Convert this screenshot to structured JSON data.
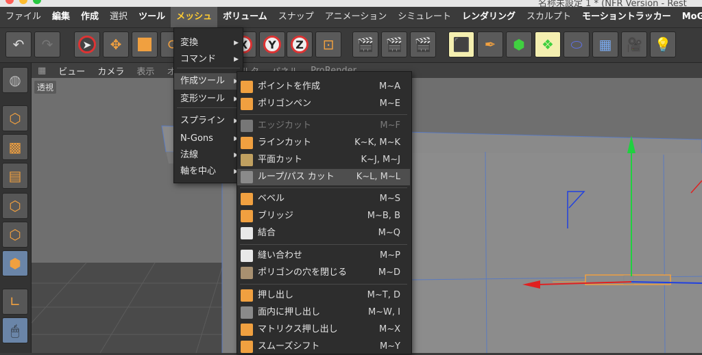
{
  "window": {
    "title": "名称未設定 1 * (NFR Version - Rest"
  },
  "menubar": {
    "items": [
      {
        "label": "ファイル",
        "style": "normal"
      },
      {
        "label": "編集",
        "style": "bold"
      },
      {
        "label": "作成",
        "style": "bold"
      },
      {
        "label": "選択",
        "style": "normal"
      },
      {
        "label": "ツール",
        "style": "bold"
      },
      {
        "label": "メッシュ",
        "style": "active"
      },
      {
        "label": "ボリューム",
        "style": "bold"
      },
      {
        "label": "スナップ",
        "style": "normal"
      },
      {
        "label": "アニメーション",
        "style": "normal"
      },
      {
        "label": "シミュレート",
        "style": "normal"
      },
      {
        "label": "レンダリング",
        "style": "bold"
      },
      {
        "label": "スカルプト",
        "style": "normal"
      },
      {
        "label": "モーショントラッカー",
        "style": "bold"
      },
      {
        "label": "MoG",
        "style": "bold"
      }
    ]
  },
  "toolbar": {
    "axis_x": "X",
    "axis_y": "Y",
    "axis_z": "Z"
  },
  "viewport_menu": {
    "items": [
      "ビュー",
      "カメラ",
      "表示",
      "オプション",
      "フィルタ",
      "パネル",
      "ProRender"
    ],
    "view_label": "透視"
  },
  "mesh_menu": {
    "items": [
      {
        "label": "変換",
        "has_submenu": true
      },
      {
        "label": "コマンド",
        "has_submenu": true
      },
      {
        "label": "作成ツール",
        "has_submenu": true,
        "active": true
      },
      {
        "label": "変形ツール",
        "has_submenu": true
      },
      {
        "label": "スプライン",
        "has_submenu": true
      },
      {
        "label": "N-Gons",
        "has_submenu": true
      },
      {
        "label": "法線",
        "has_submenu": true
      },
      {
        "label": "軸を中心",
        "has_submenu": true
      }
    ]
  },
  "create_tools_menu": {
    "items": [
      {
        "label": "ポイントを作成",
        "shortcut": "M~A",
        "icon": "point-create-icon"
      },
      {
        "label": "ポリゴンペン",
        "shortcut": "M~E",
        "icon": "polygon-pen-icon"
      },
      {
        "label": "エッジカット",
        "shortcut": "M~F",
        "icon": "edge-cut-icon",
        "disabled": true
      },
      {
        "label": "ラインカット",
        "shortcut": "K~K, M~K",
        "icon": "line-cut-icon"
      },
      {
        "label": "平面カット",
        "shortcut": "K~J, M~J",
        "icon": "plane-cut-icon"
      },
      {
        "label": "ループ/パス カット",
        "shortcut": "K~L, M~L",
        "icon": "loop-path-cut-icon",
        "highlighted": true
      },
      {
        "label": "ベベル",
        "shortcut": "M~S",
        "icon": "bevel-icon"
      },
      {
        "label": "ブリッジ",
        "shortcut": "M~B, B",
        "icon": "bridge-icon"
      },
      {
        "label": "結合",
        "shortcut": "M~Q",
        "icon": "weld-icon"
      },
      {
        "label": "縫い合わせ",
        "shortcut": "M~P",
        "icon": "stitch-icon"
      },
      {
        "label": "ポリゴンの穴を閉じる",
        "shortcut": "M~D",
        "icon": "close-hole-icon"
      },
      {
        "label": "押し出し",
        "shortcut": "M~T, D",
        "icon": "extrude-icon"
      },
      {
        "label": "面内に押し出し",
        "shortcut": "M~W, I",
        "icon": "extrude-inner-icon"
      },
      {
        "label": "マトリクス押し出し",
        "shortcut": "M~X",
        "icon": "matrix-extrude-icon"
      },
      {
        "label": "スムーズシフト",
        "shortcut": "M~Y",
        "icon": "smooth-shift-icon"
      }
    ]
  },
  "colors": {
    "accent": "#ffcc33",
    "menu_bg": "#2d2d2d",
    "menu_hover": "#4e4e4e",
    "axis_x": "#e02020",
    "axis_y": "#20d040",
    "axis_z": "#2040e0"
  }
}
